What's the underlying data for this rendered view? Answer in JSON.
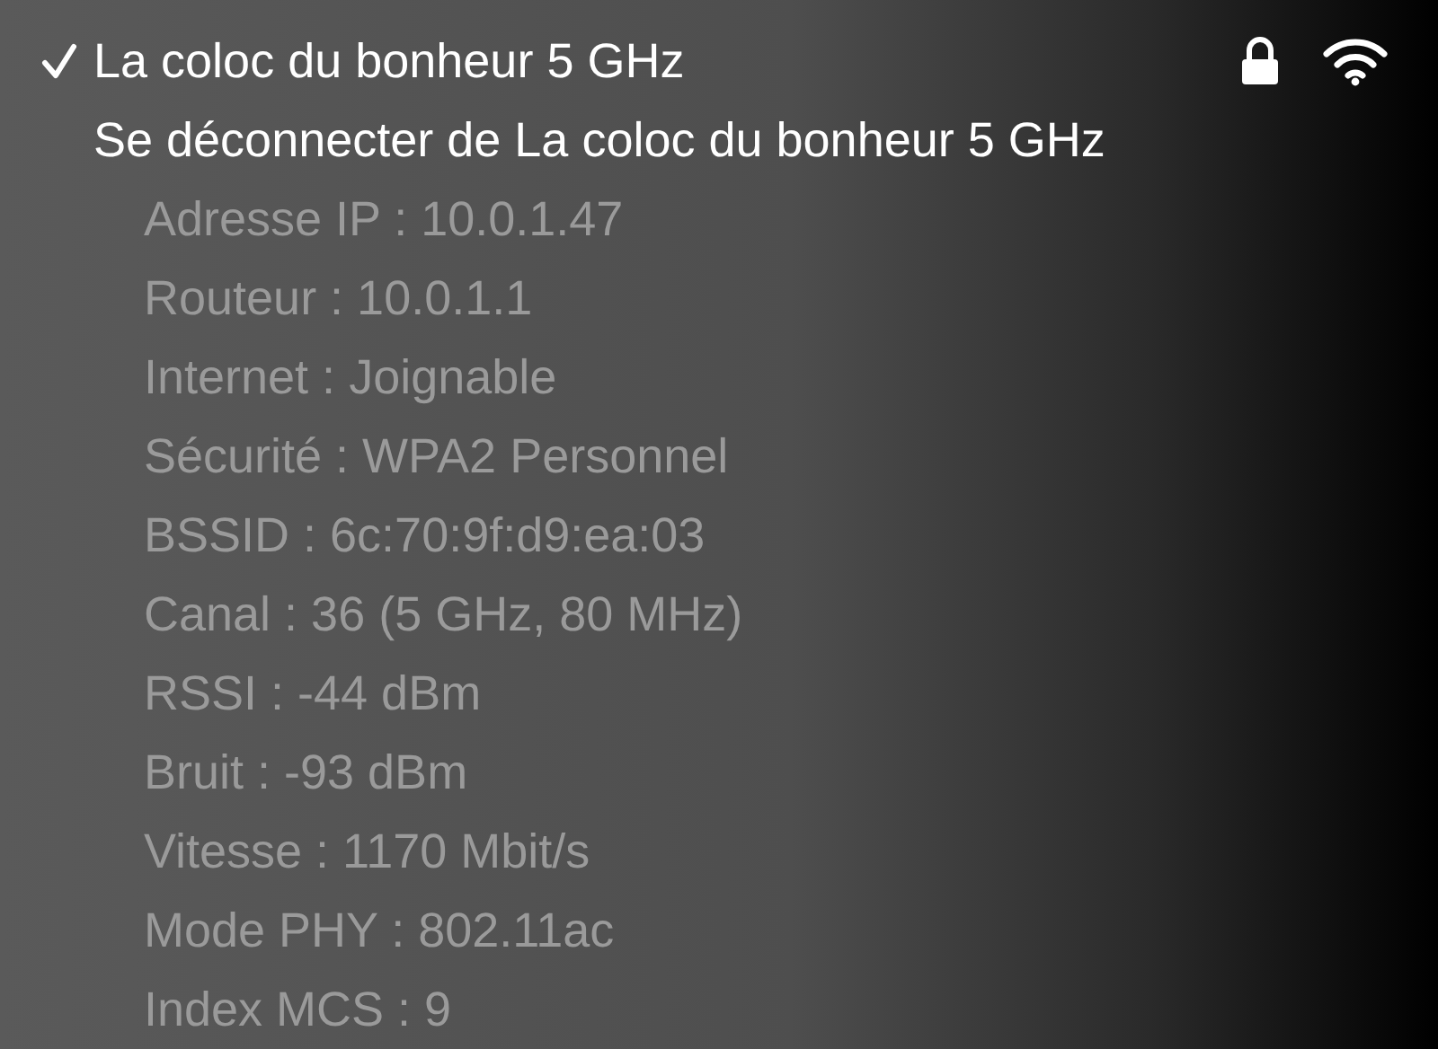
{
  "network": {
    "name": "La coloc du bonheur 5 GHz",
    "checked": true,
    "locked": true
  },
  "disconnect": "Se déconnecter de La coloc du bonheur 5 GHz",
  "details": [
    "Adresse IP : 10.0.1.47",
    "Routeur : 10.0.1.1",
    "Internet : Joignable",
    "Sécurité : WPA2 Personnel",
    "BSSID : 6c:70:9f:d9:ea:03",
    "Canal : 36 (5 GHz, 80 MHz)",
    "RSSI : -44 dBm",
    "Bruit : -93 dBm",
    "Vitesse : 1170 Mbit/s",
    "Mode PHY : 802.11ac",
    "Index MCS : 9"
  ]
}
